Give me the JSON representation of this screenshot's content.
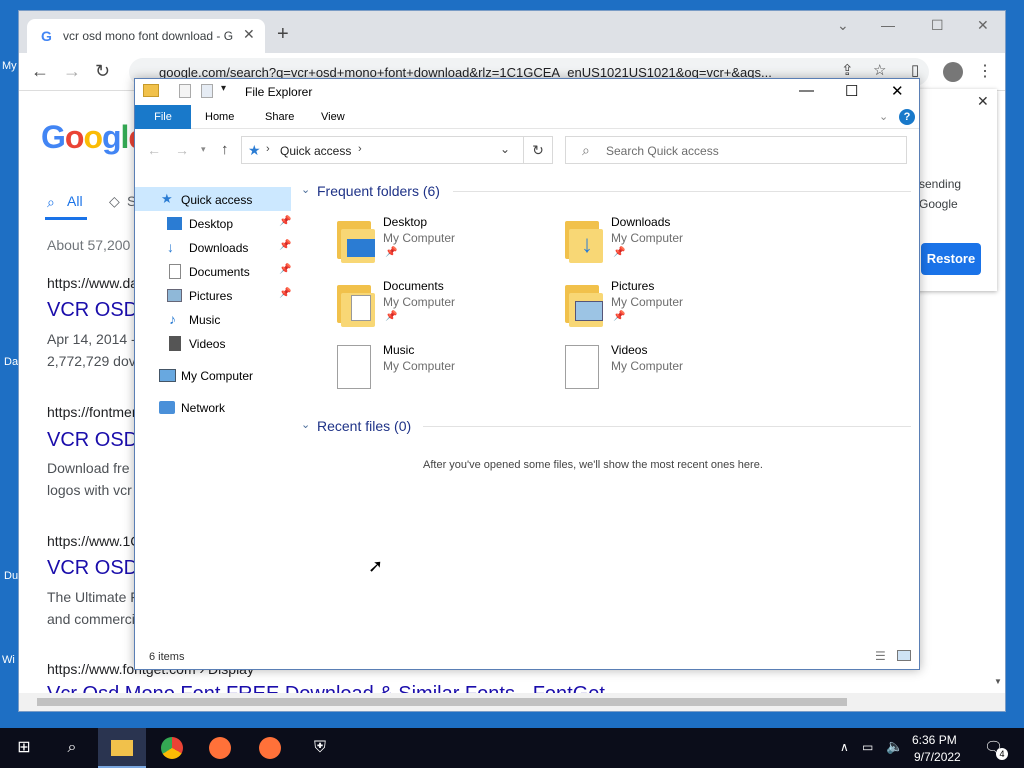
{
  "desktop": {
    "labels": [
      "My",
      "Da",
      "Du",
      "Wi"
    ]
  },
  "chrome": {
    "tab_title": "vcr osd mono font download - G",
    "tab_favicon": "G",
    "new_tab_icon": "+",
    "url": "google.com/search?q=vcr+osd+mono+font+download&rlz=1C1GCEA_enUS1021US1021&oq=vcr+&aqs...",
    "controls": {
      "minimize": "—",
      "maximize": "☐",
      "close": "✕"
    }
  },
  "google": {
    "logo": [
      "G",
      "o",
      "o",
      "g",
      "l",
      "e"
    ],
    "tabs": [
      {
        "label": "All"
      },
      {
        "label": "S"
      }
    ],
    "results_count": "About 57,200",
    "results": [
      {
        "url": "https://www.da",
        "title": "VCR OSD",
        "snippet1": "Apr 14, 2014 -",
        "snippet2": "2,772,729 dov"
      },
      {
        "url": "https://fontmer",
        "title": "VCR OSD",
        "snippet1": "Download fre",
        "snippet2": "logos with vcr"
      },
      {
        "url": "https://www.1C",
        "title": "VCR OSD",
        "snippet1": "The Ultimate F",
        "snippet2": "and commerci"
      },
      {
        "url": "https://www.fontget.com › Display",
        "title": "Vcr Osd Mono Font FREE Download & Similar Fonts - FontGet"
      }
    ],
    "popup": {
      "line1": "sending",
      "line2": "Google",
      "restore_label": "Restore",
      "close": "✕"
    }
  },
  "explorer": {
    "title": "File Explorer",
    "ribbon": {
      "file": "File",
      "home": "Home",
      "share": "Share",
      "view": "View",
      "help": "?"
    },
    "breadcrumb": "Quick access",
    "search_placeholder": "Search Quick access",
    "nav": {
      "quick_access": "Quick access",
      "items": [
        "Desktop",
        "Downloads",
        "Documents",
        "Pictures",
        "Music",
        "Videos"
      ],
      "my_computer": "My Computer",
      "network": "Network"
    },
    "frequent_header": "Frequent folders (6)",
    "folders": [
      {
        "name": "Desktop",
        "location": "My Computer",
        "pinned": true
      },
      {
        "name": "Downloads",
        "location": "My Computer",
        "pinned": true
      },
      {
        "name": "Documents",
        "location": "My Computer",
        "pinned": true
      },
      {
        "name": "Pictures",
        "location": "My Computer",
        "pinned": true
      },
      {
        "name": "Music",
        "location": "My Computer",
        "pinned": false
      },
      {
        "name": "Videos",
        "location": "My Computer",
        "pinned": false
      }
    ],
    "recent_header": "Recent files (0)",
    "recent_empty": "After you've opened some files, we'll show the most recent ones here.",
    "status": "6 items"
  },
  "taskbar": {
    "time": "6:36 PM",
    "date": "9/7/2022",
    "notifications": "4"
  },
  "colors": {
    "accent": "#1979ca",
    "desktop": "#1e6fc4",
    "taskbar": "#0b0d1a",
    "link": "#1a0dab"
  }
}
